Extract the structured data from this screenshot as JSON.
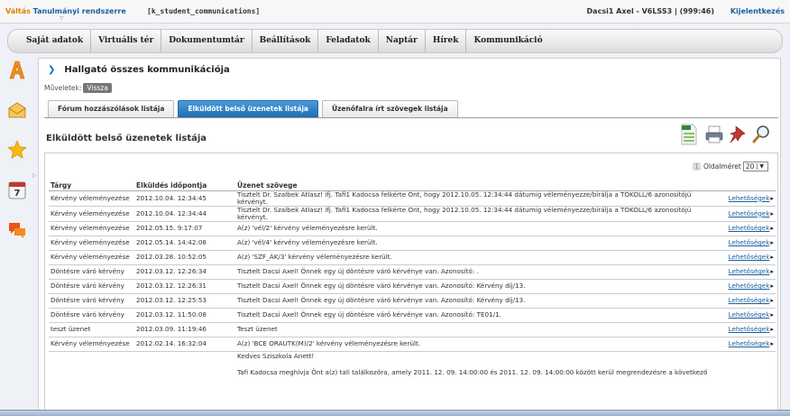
{
  "header": {
    "app_title_hl": "Váltás",
    "app_title_rest": " Tanulmányi rendszerre",
    "context": "[k_student_communications]",
    "user_info": "Dacsi1 Axel - V6LSS3  |  (999:46)",
    "logout": "Kijelentkezés"
  },
  "nav": [
    "Saját adatok",
    "Virtuális tér",
    "Dokumentumtár",
    "Beállítások",
    "Feladatok",
    "Naptár",
    "Hírek",
    "Kommunikáció"
  ],
  "side_icons": [
    {
      "name": "a-letter-icon",
      "color": "#f28c1a"
    },
    {
      "name": "envelope-icon",
      "color": "#e8a52a"
    },
    {
      "name": "star-icon",
      "color": "#f2b21a"
    },
    {
      "name": "calendar-icon",
      "color": "#c0392b",
      "text": "7"
    },
    {
      "name": "chat-bubbles-icon",
      "color": "#e05a1a"
    }
  ],
  "panel": {
    "heading": "Hallgató összes kommunikációja",
    "ops_label": "Műveletek:",
    "back_label": "Vissza",
    "tabs": [
      {
        "label": "Fórum hozzászólások listája",
        "active": false
      },
      {
        "label": "Elküldött belső üzenetek listája",
        "active": true
      },
      {
        "label": "Üzenőfalra írt szövegek listája",
        "active": false
      }
    ],
    "section_title": "Elküldött belső üzenetek listája",
    "tools": [
      "excel-export-icon",
      "print-icon",
      "pin-icon",
      "search-icon"
    ]
  },
  "pager": {
    "page": "1",
    "label": "Oldalméret",
    "size": "20"
  },
  "table": {
    "headers": [
      "Tárgy",
      "Elküldés időpontja",
      "Üzenet szövege",
      ""
    ],
    "link_label": "Lehetőségek",
    "rows": [
      {
        "subject": "Kérvény véleményezése",
        "date": "2012.10.04. 12:34:45",
        "text": "Tisztelt Dr. Szalbek Atlasz! ifj. Tafi1 Kadocsa felkérte Önt, hogy 2012.10.05. 12:34:44 dátumig véleményezze/bírálja a TÖKOLL/6 azonosítójú kérvényt."
      },
      {
        "subject": "Kérvény véleményezése",
        "date": "2012.10.04. 12:34:44",
        "text": "Tisztelt Dr. Szalbek Atlasz! ifj. Tafi1 Kadocsa felkérte Önt, hogy 2012.10.05. 12:34:44 dátumig véleményezze/bírálja a TÖKOLL/6 azonosítójú kérvényt."
      },
      {
        "subject": "Kérvény véleményezése",
        "date": "2012.05.15. 9:17:07",
        "text": "A(z) 'vél/2' kérvény véleményezésre került."
      },
      {
        "subject": "Kérvény véleményezése",
        "date": "2012.05.14. 14:42:08",
        "text": "A(z) 'vél/4' kérvény véleményezésre került."
      },
      {
        "subject": "Kérvény véleményezése",
        "date": "2012.03.28. 10:52:05",
        "text": "A(z) 'SZF_ÁK/3' kérvény véleményezésre került."
      },
      {
        "subject": "Döntésre váró kérvény",
        "date": "2012.03.12. 12:26:34",
        "text": "Tisztelt Dacsi Axel! Önnek egy új döntésre váró kérvénye van. Azonosító: ."
      },
      {
        "subject": "Döntésre váró kérvény",
        "date": "2012.03.12. 12:26:31",
        "text": "Tisztelt Dacsi Axel! Önnek egy új döntésre váró kérvénye van. Azonosító: Kérvény díj/13."
      },
      {
        "subject": "Döntésre váró kérvény",
        "date": "2012.03.12. 12:25:53",
        "text": "Tisztelt Dacsi Axel! Önnek egy új döntésre váró kérvénye van. Azonosító: Kérvény díj/13."
      },
      {
        "subject": "Döntésre váró kérvény",
        "date": "2012.03.12. 11:50:08",
        "text": "Tisztelt Dacsi Axel! Önnek egy új döntésre váró kérvénye van. Azonosító: TE01/1."
      },
      {
        "subject": "teszt üzenet",
        "date": "2012.03.09. 11:19:46",
        "text": "Teszt üzenet"
      },
      {
        "subject": "Kérvény véleményezése",
        "date": "2012.02.14. 16:32:04",
        "text": "A(z) 'BCE ORAUTK(M)/2' kérvény véleményezésre került."
      }
    ],
    "open_message": {
      "line1": "Kedves Sziszkola Anett!",
      "line2": "Tafi Kadocsa meghívja Önt a(z) tali találkozóra, amely 2011. 12. 09. 14:00:00 és 2011. 12. 09. 14:00:00 között kerül megrendezésre a következő"
    }
  }
}
